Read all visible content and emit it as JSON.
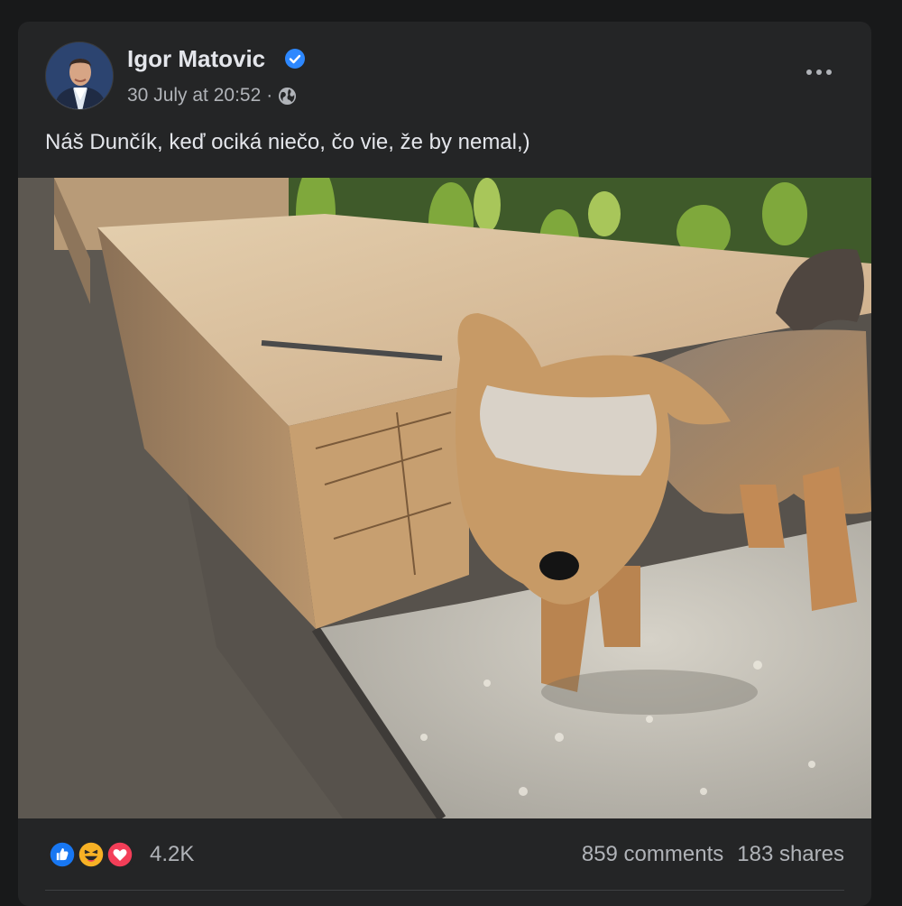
{
  "post": {
    "author": "Igor Matovic",
    "verified": true,
    "timestamp": "30 July at 20:52",
    "separator": "·",
    "audience_icon": "globe-icon",
    "more_icon": "more-dots-icon",
    "text": "Náš Dunčík, keď ociká niečo, čo vie, že by nemal,)",
    "photo_subject": "Yorkshire terrier sniffing a wooden raised garden bed on gravel"
  },
  "engagement": {
    "reaction_icons": [
      "like-icon",
      "haha-icon",
      "love-icon"
    ],
    "reaction_count": "4.2K",
    "comments": "859 comments",
    "shares": "183 shares"
  },
  "colors": {
    "page_bg": "#18191a",
    "card_bg": "#242526",
    "primary_text": "#e4e6eb",
    "secondary_text": "#b0b3b8",
    "verified_blue": "#2d88ff",
    "like_blue": "#1877f2",
    "love_red": "#f33e58",
    "haha_yellow": "#f7b125"
  }
}
